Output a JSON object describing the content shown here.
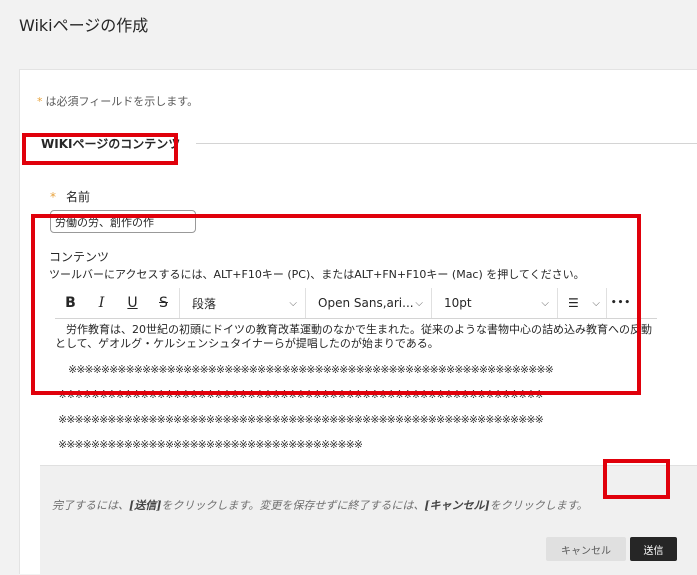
{
  "page": {
    "title": "Wikiページの作成"
  },
  "form": {
    "required_star": "*",
    "required_note": "は必須フィールドを示します。",
    "section_title": "WIKIページのコンテンツ",
    "name_label": "名前",
    "name_value": "労働の労、創作の作",
    "content_label": "コンテンツ",
    "content_help": "ツールバーにアクセスするには、ALT+F10キー (PC)、またはALT+FN+F10キー (Mac) を押してください。"
  },
  "toolbar": {
    "bold": "B",
    "italic": "I",
    "underline": "U",
    "strike": "S",
    "paragraph": "段落",
    "font": "Open Sans,ari...",
    "size": "10pt",
    "list_icon": "☰",
    "more": "•••",
    "chevron": "⌵"
  },
  "editor": {
    "paragraph": "　労作教育は、20世紀の初頭にドイツの教育改革運動のなかで生まれた。従来のような書物中心の詰め込み教育への反動として、ゲオルグ・ケルシェンシュタイナーらが提唱したのが始まりである。",
    "star_lines": [
      "　※※※※※※※※※※※※※※※※※※※※※※※※※※※※※※※※※※※※※※※※※※※※※※※※※※※※※※※※※※※",
      "※※※※※※※※※※※※※※※※※※※※※※※※※※※※※※※※※※※※※※※※※※※※※※※※※※※※※※※※※※※",
      "※※※※※※※※※※※※※※※※※※※※※※※※※※※※※※※※※※※※※※※※※※※※※※※※※※※※※※※※※※※",
      "※※※※※※※※※※※※※※※※※※※※※※※※※※※※※※※※※※※※※"
    ]
  },
  "footer": {
    "note_prefix": "完了するには、",
    "note_submit": "[送信]",
    "note_middle": "をクリックします。変更を保存せずに終了するには、",
    "note_cancel": "[キャンセル]",
    "note_suffix": "をクリックします。",
    "cancel_label": "キャンセル",
    "submit_label": "送信"
  },
  "colors": {
    "highlight": "#e0000b",
    "required": "#e8a33d",
    "submit_bg": "#262626"
  }
}
